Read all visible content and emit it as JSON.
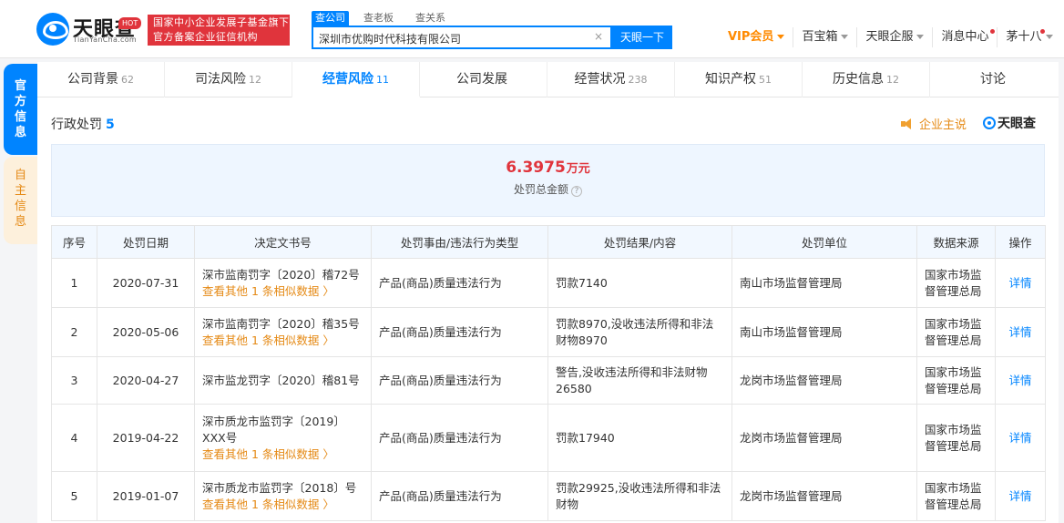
{
  "header": {
    "logo_title": "天眼查",
    "logo_sub": "TianYanCha.com",
    "slogan_line1": "国家中小企业发展子基金旗下",
    "slogan_line2": "官方备案企业征信机构",
    "search_tabs": [
      "查公司",
      "查老板",
      "查关系"
    ],
    "search_value": "深圳市优购时代科技有限公司",
    "search_clear": "×",
    "search_button": "天眼一下",
    "nav": {
      "vip": "VIP会员",
      "baibao": "百宝箱",
      "hot": "HOT",
      "enterprise": "天眼企服",
      "messages": "消息中心",
      "user": "茅十八"
    }
  },
  "side": {
    "official": [
      "官",
      "方",
      "信",
      "息"
    ],
    "self": [
      "自",
      "主",
      "信",
      "息"
    ]
  },
  "tabs": [
    {
      "label": "公司背景",
      "count": "62"
    },
    {
      "label": "司法风险",
      "count": "12"
    },
    {
      "label": "经营风险",
      "count": "11"
    },
    {
      "label": "公司发展",
      "count": ""
    },
    {
      "label": "经营状况",
      "count": "238"
    },
    {
      "label": "知识产权",
      "count": "51"
    },
    {
      "label": "历史信息",
      "count": "12"
    },
    {
      "label": "讨论",
      "count": ""
    }
  ],
  "section": {
    "title": "行政处罚",
    "count": "5",
    "promo": "企业主说",
    "brand": "天眼查"
  },
  "summary": {
    "amount": "6.3975",
    "unit": "万元",
    "label": "处罚总金额",
    "help": "?"
  },
  "table": {
    "headers": [
      "序号",
      "处罚日期",
      "决定文书号",
      "处罚事由/违法行为类型",
      "处罚结果/内容",
      "处罚单位",
      "数据来源",
      "操作"
    ],
    "rows": [
      {
        "no": "1",
        "date": "2020-07-31",
        "doc": "深市监南罚字〔2020〕稽72号",
        "more": "查看其他 1 条相似数据 〉",
        "reason": "产品(商品)质量违法行为",
        "result": "罚款7140",
        "unit": "南山市场监督管理局",
        "source": "国家市场监督管理总局",
        "action": "详情"
      },
      {
        "no": "2",
        "date": "2020-05-06",
        "doc": "深市监南罚字〔2020〕稽35号",
        "more": "查看其他 1 条相似数据 〉",
        "reason": "产品(商品)质量违法行为",
        "result": "罚款8970,没收违法所得和非法财物8970",
        "unit": "南山市场监督管理局",
        "source": "国家市场监督管理总局",
        "action": "详情"
      },
      {
        "no": "3",
        "date": "2020-04-27",
        "doc": "深市监龙罚字〔2020〕稽81号",
        "more": "",
        "reason": "产品(商品)质量违法行为",
        "result": "警告,没收违法所得和非法财物26580",
        "unit": "龙岗市场监督管理局",
        "source": "国家市场监督管理总局",
        "action": "详情"
      },
      {
        "no": "4",
        "date": "2019-04-22",
        "doc": "深市质龙市监罚字〔2019〕XXX号",
        "more": "查看其他 1 条相似数据 〉",
        "reason": "产品(商品)质量违法行为",
        "result": "罚款17940",
        "unit": "龙岗市场监督管理局",
        "source": "国家市场监督管理总局",
        "action": "详情"
      },
      {
        "no": "5",
        "date": "2019-01-07",
        "doc": "深市质龙市监罚字〔2018〕号",
        "more": "查看其他 1 条相似数据 〉",
        "reason": "产品(商品)质量违法行为",
        "result": "罚款29925,没收违法所得和非法财物",
        "unit": "龙岗市场监督管理局",
        "source": "国家市场监督管理总局",
        "action": "详情"
      }
    ]
  }
}
